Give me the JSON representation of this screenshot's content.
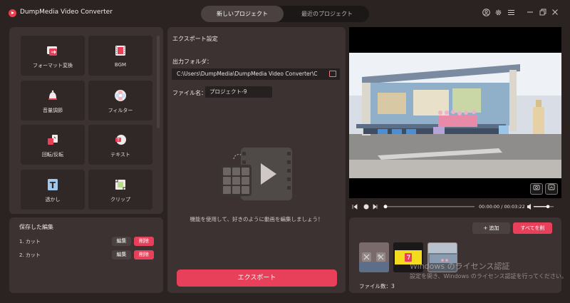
{
  "app": {
    "title": "DumpMedia Video Converter"
  },
  "tabs": [
    {
      "label": "新しいプロジェクト",
      "active": true
    },
    {
      "label": "最近のプロジェクト",
      "active": false
    }
  ],
  "tools": [
    {
      "label": "フォーマット変換",
      "icon": "format-convert-icon"
    },
    {
      "label": "BGM",
      "icon": "bgm-film-icon"
    },
    {
      "label": "音量調節",
      "icon": "volume-bell-icon"
    },
    {
      "label": "フィルター",
      "icon": "filter-flower-icon"
    },
    {
      "label": "回転/反転",
      "icon": "rotate-icon"
    },
    {
      "label": "テキスト",
      "icon": "text-icon"
    },
    {
      "label": "透かし",
      "icon": "watermark-icon"
    },
    {
      "label": "クリップ",
      "icon": "clip-icon"
    }
  ],
  "saved": {
    "title": "保存した編集",
    "items": [
      {
        "label": "1.  カット"
      },
      {
        "label": "2.  カット"
      }
    ],
    "edit_label": "編集",
    "delete_label": "削除"
  },
  "export": {
    "title": "エクスポート設定",
    "folder_label": "出力フォルダ：",
    "folder_path": "C:\\Users\\DumpMedia\\DumpMedia Video Converter\\C",
    "filename_label": "ファイル名：",
    "filename_value": "プロジェクト-9",
    "hint": "機能を使用して、好きのように動画を編集しましょう！",
    "export_button": "エクスポート"
  },
  "player": {
    "time": "00:00:00 / 00:03:22",
    "progress": 0.0,
    "volume": 0.7
  },
  "files": {
    "add_label": "+ 追加",
    "delete_all_label": "すべてを削",
    "count_label": "ファイル数：3",
    "watermark_title": "Windows のライセンス認証",
    "watermark_sub": "設定を開き、Windows のライセンス認証を行ってください。"
  },
  "colors": {
    "accent": "#e8405a",
    "panel": "#3b3231",
    "background": "#2a2322"
  }
}
